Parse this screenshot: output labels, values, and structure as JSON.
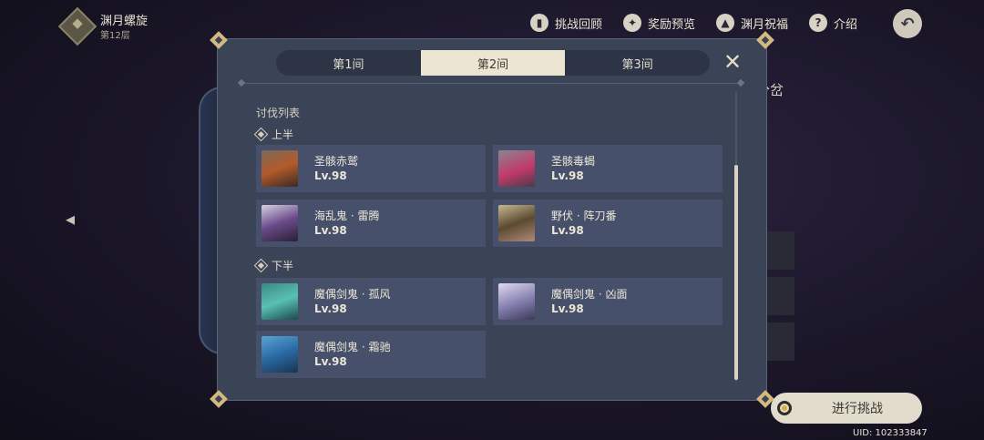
{
  "header": {
    "title": "渊月螺旋",
    "floor": "第12层"
  },
  "top_buttons": [
    {
      "label": "挑战回顾",
      "icon": "book-icon"
    },
    {
      "label": "奖励预览",
      "icon": "gift-icon"
    },
    {
      "label": "渊月祝福",
      "icon": "blessing-icon"
    },
    {
      "label": "介绍",
      "icon": "help-icon"
    }
  ],
  "background": {
    "side_text": "分岔"
  },
  "dialog": {
    "tabs": [
      "第1间",
      "第2间",
      "第3间"
    ],
    "active_tab": 1,
    "section_title": "讨伐列表",
    "first_half": {
      "label": "上半",
      "enemies": [
        {
          "name": "圣骸赤鹫",
          "level": "Lv.98"
        },
        {
          "name": "圣骸毒蝎",
          "level": "Lv.98"
        },
        {
          "name": "海乱鬼 · 雷腾",
          "level": "Lv.98"
        },
        {
          "name": "野伏 · 阵刀番",
          "level": "Lv.98"
        }
      ]
    },
    "second_half": {
      "label": "下半",
      "enemies": [
        {
          "name": "魔偶剑鬼 · 孤风",
          "level": "Lv.98"
        },
        {
          "name": "魔偶剑鬼 · 凶面",
          "level": "Lv.98"
        },
        {
          "name": "魔偶剑鬼 · 霜驰",
          "level": "Lv.98"
        }
      ]
    }
  },
  "start_button": {
    "label": "进行挑战"
  },
  "uid": "UID: 102333847"
}
